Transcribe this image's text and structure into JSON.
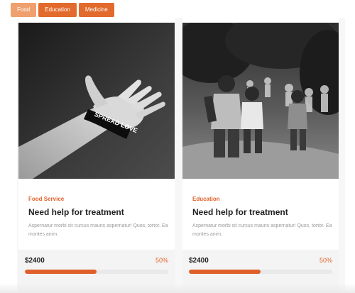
{
  "filters": [
    {
      "label": "Food",
      "active": true
    },
    {
      "label": "Education",
      "active": false
    },
    {
      "label": "Medicine",
      "active": false
    }
  ],
  "cards": [
    {
      "category": "Food Service",
      "title": "Need help for treatment",
      "description": "Aspernatur morbi sit cursus mauris aspernatur! Quos, tortor. Ea montes anim.",
      "amount": "$2400",
      "percent": "50%",
      "progress": 0.5,
      "image_icon": "hand-wristband-photo",
      "image_text": "SPREAD LOVE"
    },
    {
      "category": "Education",
      "title": "Need help for treatment",
      "description": "Aspernatur morbi sit cursus mauris aspernatur! Quos, tortor. Ea montes anim.",
      "amount": "$2400",
      "percent": "50%",
      "progress": 0.5,
      "image_icon": "running-children-photo"
    }
  ],
  "colors": {
    "accent": "#e26a2c",
    "accent_light": "#f0a06f",
    "progress": "#df5f2b"
  }
}
